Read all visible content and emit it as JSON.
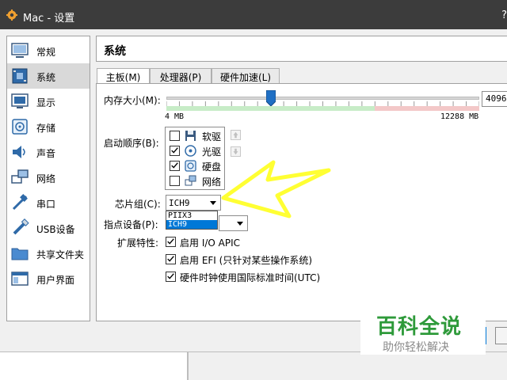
{
  "window": {
    "title": "Mac - 设置",
    "help": "?"
  },
  "sidebar": {
    "items": [
      {
        "label": "常规",
        "icon": "general-icon"
      },
      {
        "label": "系统",
        "icon": "system-icon",
        "selected": true
      },
      {
        "label": "显示",
        "icon": "display-icon"
      },
      {
        "label": "存储",
        "icon": "storage-icon"
      },
      {
        "label": "声音",
        "icon": "audio-icon"
      },
      {
        "label": "网络",
        "icon": "network-icon"
      },
      {
        "label": "串口",
        "icon": "serial-port-icon"
      },
      {
        "label": "USB设备",
        "icon": "usb-icon"
      },
      {
        "label": "共享文件夹",
        "icon": "shared-folder-icon"
      },
      {
        "label": "用户界面",
        "icon": "user-interface-icon"
      }
    ]
  },
  "header": {
    "title": "系统"
  },
  "tabs": [
    {
      "label": "主板(M)",
      "active": true
    },
    {
      "label": "处理器(P)",
      "active": false
    },
    {
      "label": "硬件加速(L)",
      "active": false
    }
  ],
  "motherboard": {
    "memory": {
      "label": "内存大小(M):",
      "value": "4096",
      "min_label": "4 MB",
      "max_label": "12288 MB",
      "min_mb": 4,
      "max_mb": 12288,
      "current_mb": 4096,
      "recommended_max_mb": 8192
    },
    "boot_order": {
      "label": "启动顺序(B):",
      "items": [
        {
          "label": "软驱",
          "checked": false,
          "icon": "floppy-icon"
        },
        {
          "label": "光驱",
          "checked": true,
          "icon": "optical-disc-icon"
        },
        {
          "label": "硬盘",
          "checked": true,
          "icon": "hard-disk-icon"
        },
        {
          "label": "网络",
          "checked": false,
          "icon": "network-boot-icon"
        }
      ]
    },
    "chipset": {
      "label": "芯片组(C):",
      "value": "ICH9",
      "options": [
        "PIIX3",
        "ICH9"
      ],
      "selected_option": "ICH9"
    },
    "pointing_device": {
      "label": "指点设备(P):"
    },
    "extended": {
      "label": "扩展特性:",
      "features": [
        {
          "label": "启用 I/O APIC",
          "checked": true
        },
        {
          "label": "启用 EFI (只针对某些操作系统)",
          "checked": false
        },
        {
          "label": "硬件时钟使用国际标准时间(UTC)",
          "checked": true
        }
      ]
    }
  },
  "watermark": {
    "title": "百科全说",
    "subtitle": "助你轻松解决"
  },
  "colors": {
    "titlebar": "#3c3c3c",
    "selection": "#0078d7",
    "watermark": "#2e9a3a",
    "arrow": "#ffff33"
  }
}
